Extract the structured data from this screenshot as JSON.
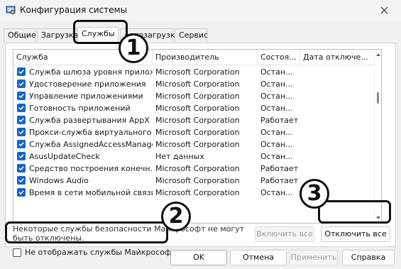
{
  "window": {
    "title": "Конфигурация системы",
    "icon": "system-config-icon"
  },
  "tabs": [
    {
      "label": "Общие",
      "active": false
    },
    {
      "label": "Загрузка",
      "active": false
    },
    {
      "label": "Службы",
      "active": true
    },
    {
      "label": "Автозагрузка",
      "active": false
    },
    {
      "label": "Сервис",
      "active": false
    }
  ],
  "services": {
    "columns": [
      "Служба",
      "Производитель",
      "Состоя...",
      "Дата отключе..."
    ],
    "rows": [
      {
        "name": "Служба шлюза уровня прилож...",
        "vendor": "Microsoft Corporation",
        "state": "Остан...",
        "date": "",
        "checked": true
      },
      {
        "name": "Удостоверение приложения",
        "vendor": "Microsoft Corporation",
        "state": "Остан...",
        "date": "",
        "checked": true
      },
      {
        "name": "Управление приложениями",
        "vendor": "Microsoft Corporation",
        "state": "Остан...",
        "date": "",
        "checked": true
      },
      {
        "name": "Готовность приложений",
        "vendor": "Microsoft Corporation",
        "state": "Остан...",
        "date": "",
        "checked": true
      },
      {
        "name": "Служба развертывания AppX (...",
        "vendor": "Microsoft Corporation",
        "state": "Работает",
        "date": "",
        "checked": true
      },
      {
        "name": "Прокси-служба виртуального ...",
        "vendor": "Microsoft Corporation",
        "state": "Остан...",
        "date": "",
        "checked": true
      },
      {
        "name": "Служба AssignedAccessManager",
        "vendor": "Microsoft Corporation",
        "state": "Остан...",
        "date": "",
        "checked": true
      },
      {
        "name": "AsusUpdateCheck",
        "vendor": "Нет данных",
        "state": "Остан...",
        "date": "",
        "checked": true
      },
      {
        "name": "Средство построения конечн...",
        "vendor": "Microsoft Corporation",
        "state": "Работает",
        "date": "",
        "checked": true
      },
      {
        "name": "Windows Audio",
        "vendor": "Microsoft Corporation",
        "state": "Работает",
        "date": "",
        "checked": true
      },
      {
        "name": "Время в сети мобильной связи",
        "vendor": "Microsoft Corporation",
        "state": "Остан...",
        "date": "",
        "checked": true
      }
    ]
  },
  "note": "Некоторые службы безопасности Майкрософт не могут быть отключены.",
  "enable_all": "Включить все",
  "disable_all": "Отключить все",
  "hide_ms": {
    "label": "Не отображать службы Майкрософт",
    "checked": false
  },
  "buttons": {
    "ok": "OK",
    "cancel": "Отмена",
    "apply": "Применить",
    "help": "Справка"
  },
  "annotations": [
    "1",
    "2",
    "3"
  ],
  "colors": {
    "checkbox": "#1565c0",
    "window_bg": "#f0f0f0",
    "highlight": "#111111"
  }
}
